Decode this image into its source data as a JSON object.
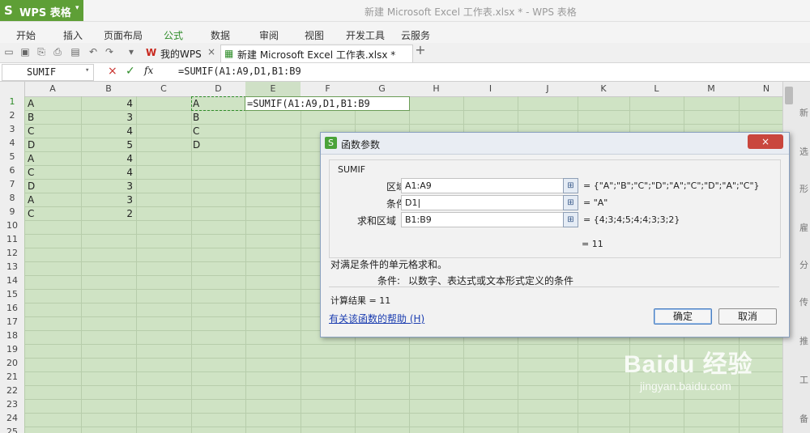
{
  "app": {
    "name": "WPS 表格",
    "logo": "S",
    "dropdown": "▾",
    "window_title": "新建 Microsoft Excel 工作表.xlsx * - WPS 表格"
  },
  "menu": {
    "items": [
      "开始",
      "插入",
      "页面布局",
      "公式",
      "数据",
      "审阅",
      "视图",
      "开发工具",
      "云服务"
    ],
    "active": "公式"
  },
  "tabs": {
    "home_label": "我的WPS",
    "doc_label": "新建 Microsoft Excel 工作表.xlsx *",
    "close": "×",
    "add": "+"
  },
  "formula_bar": {
    "name_box": "SUMIF",
    "cancel": "×",
    "confirm": "✓",
    "fx": "fx",
    "content": "=SUMIF(A1:A9,D1,B1:B9"
  },
  "grid": {
    "columns": [
      "A",
      "B",
      "C",
      "D",
      "E",
      "F",
      "G",
      "H",
      "I",
      "J",
      "K",
      "L",
      "M",
      "N"
    ],
    "rows": [
      "1",
      "2",
      "3",
      "4",
      "5",
      "6",
      "7",
      "8",
      "9",
      "10",
      "11",
      "12",
      "13",
      "14",
      "15",
      "16",
      "17",
      "18",
      "19",
      "20",
      "21",
      "22",
      "23",
      "24",
      "25"
    ],
    "colA": [
      "A",
      "B",
      "C",
      "D",
      "A",
      "C",
      "D",
      "A",
      "C"
    ],
    "colB": [
      "4",
      "3",
      "4",
      "5",
      "4",
      "4",
      "3",
      "3",
      "2"
    ],
    "colD": [
      "A",
      "B",
      "C",
      "D"
    ],
    "e1": "=SUMIF(A1:A9,D1,B1:B9"
  },
  "right_sidebar": [
    "新",
    "选",
    "形",
    "雇",
    "分",
    "传",
    "推",
    "工",
    "备"
  ],
  "dialog": {
    "title": "函数参数",
    "close": "×",
    "function_name": "SUMIF",
    "args": [
      {
        "label": "区域",
        "value": "A1:A9",
        "result": "= {\"A\";\"B\";\"C\";\"D\";\"A\";\"C\";\"D\";\"A\";\"C\"}"
      },
      {
        "label": "条件",
        "value": "D1|",
        "result": "= \"A\""
      },
      {
        "label": "求和区域",
        "value": "B1:B9",
        "result": "= {4;3;4;5;4;4;3;3;2}"
      }
    ],
    "formula_result": "= 11",
    "description": "对满足条件的单元格求和。",
    "arg_help_label": "条件:",
    "arg_help_text": "以数字、表达式或文本形式定义的条件",
    "calc_result": "计算结果 = 11",
    "help_link": "有关该函数的帮助 (H)",
    "ok": "确定",
    "cancel": "取消"
  },
  "watermark": {
    "brand": "Baidu 经验",
    "url": "jingyan.baidu.com"
  }
}
